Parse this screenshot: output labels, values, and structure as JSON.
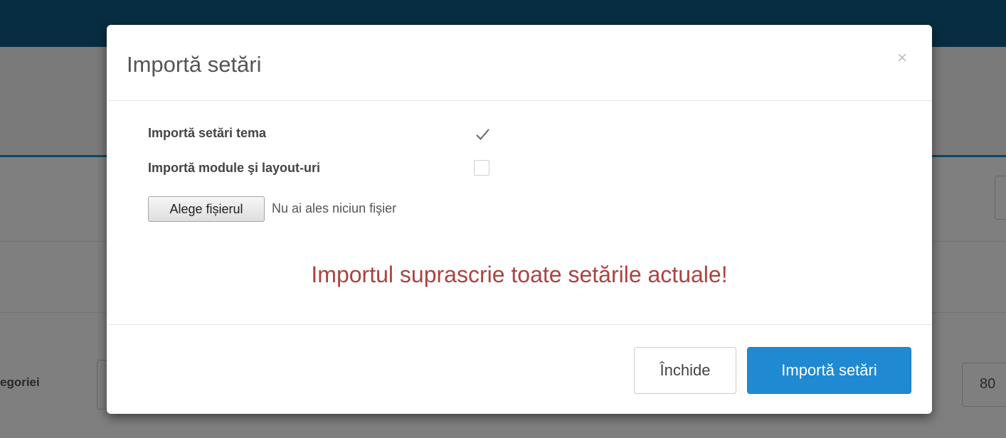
{
  "background": {
    "category_label_fragment": "egoriei",
    "input_value_fragment": "80"
  },
  "modal": {
    "title": "Importă setări",
    "close_symbol": "×",
    "options": [
      {
        "label": "Importă setări tema",
        "checked": true
      },
      {
        "label": "Importă module şi layout-uri",
        "checked": false
      }
    ],
    "file": {
      "button_label": "Alege fișierul",
      "status": "Nu ai ales niciun fişier"
    },
    "warning": "Importul suprascrie toate setările actuale!",
    "footer": {
      "close_label": "Închide",
      "import_label": "Importă setări"
    }
  },
  "colors": {
    "topbar": "#0f5a84",
    "accent_line": "#1d8fcc",
    "primary_button": "#1f8ad2",
    "warning_text": "#a94442"
  },
  "icons": {
    "checkmark": "check-icon",
    "close": "close-icon"
  }
}
